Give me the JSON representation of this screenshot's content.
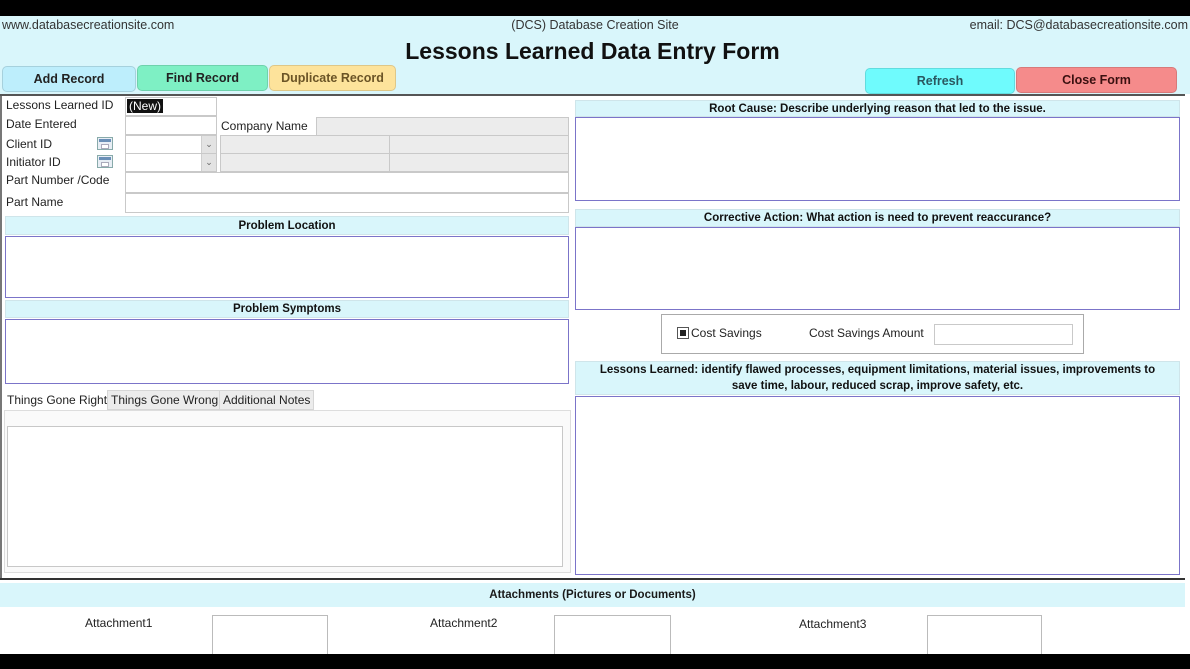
{
  "header": {
    "site_url": "www.databasecreationsite.com",
    "site_name": "(DCS) Database Creation Site",
    "site_email": "email: DCS@databasecreationsite.com",
    "form_title": "Lessons Learned Data Entry Form"
  },
  "toolbar": {
    "add_record": "Add Record",
    "find_record": "Find Record",
    "duplicate_record": "Duplicate Record",
    "refresh": "Refresh",
    "close_form": "Close Form"
  },
  "colors": {
    "header_bg": "#d9f6fb",
    "add_record": "#bdeefc",
    "find_record": "#7ef0c4",
    "duplicate_record": "#fde39b",
    "refresh": "#6ffbfd",
    "close_form": "#f58b8b",
    "memo_border": "#7b74c9"
  },
  "fields": {
    "lessons_learned_id": {
      "label": "Lessons Learned ID",
      "value": "(New)"
    },
    "date_entered": {
      "label": "Date Entered",
      "value": ""
    },
    "company_name": {
      "label": "Company Name",
      "value": ""
    },
    "client_id": {
      "label": "Client ID",
      "value": "",
      "icon": "calendar-icon"
    },
    "initiator_id": {
      "label": "Initiator ID",
      "value": "",
      "icon": "calendar-icon"
    },
    "part_number": {
      "label": "Part Number /Code",
      "value": ""
    },
    "part_name": {
      "label": "Part Name",
      "value": ""
    }
  },
  "sections": {
    "problem_location": "Problem Location",
    "problem_symptoms": "Problem Symptoms",
    "root_cause": "Root Cause: Describe underlying reason that led to the issue.",
    "corrective_action": "Corrective Action: What action is need to prevent reaccurance?",
    "lessons_learned": "Lessons Learned: identify flawed processes, equipment limitations, material issues, improvements to save time, labour, reduced scrap, improve safety, etc."
  },
  "tabs": [
    {
      "label": "Things Gone Right",
      "active": true
    },
    {
      "label": "Things Gone Wrong",
      "active": false
    },
    {
      "label": "Additional Notes",
      "active": false
    }
  ],
  "cost": {
    "checkbox_label": "Cost Savings",
    "checked": true,
    "amount_label": "Cost Savings Amount",
    "amount_value": ""
  },
  "attachments": {
    "heading": "Attachments (Pictures or Documents)",
    "items": [
      "Attachment1",
      "Attachment2",
      "Attachment3"
    ]
  }
}
